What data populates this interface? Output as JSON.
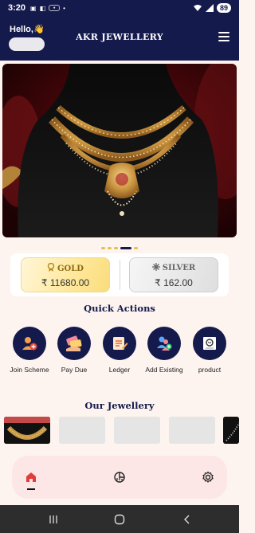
{
  "status_bar": {
    "time": "3:20",
    "battery": "89",
    "icons": [
      "notification-icon",
      "wifi-icon",
      "signal-icon",
      "battery-icon"
    ]
  },
  "header": {
    "greeting": "Hello,👋",
    "title": "AKR JEWELLERY",
    "menu_icon": "hamburger-menu-icon"
  },
  "banner": {
    "image": "gold-necklace-photo",
    "slides": 5,
    "active_slide": 4
  },
  "rates": {
    "gold": {
      "label": "GOLD",
      "value": "₹ 11680.00",
      "icon": "medal-icon"
    },
    "silver": {
      "label": "SILVER",
      "value": "₹ 162.00",
      "icon": "snowflake-icon"
    }
  },
  "quick_actions": {
    "title": "Quick Actions",
    "items": [
      {
        "label": "Join Scheme",
        "icon": "join-scheme-icon"
      },
      {
        "label": "Pay Due",
        "icon": "pay-due-icon"
      },
      {
        "label": "Ledger",
        "icon": "ledger-icon"
      },
      {
        "label": "Add Existing",
        "icon": "add-existing-icon"
      },
      {
        "label": "product",
        "icon": "product-icon"
      }
    ]
  },
  "jewellery": {
    "title": "Our Jewellery"
  },
  "bottom_nav": {
    "items": [
      "home-icon",
      "chart-icon",
      "settings-icon"
    ],
    "active": "home-icon"
  },
  "colors": {
    "primary": "#151a4d",
    "gold": "#ffe89a",
    "silver": "#dedede",
    "background": "#fdf4ef",
    "nav": "#fde7e6"
  }
}
